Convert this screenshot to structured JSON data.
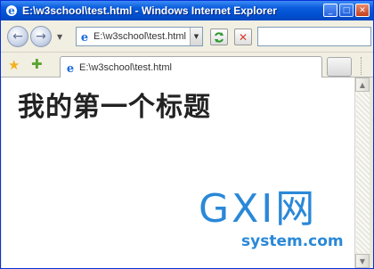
{
  "window": {
    "title": "E:\\w3school\\test.html - Windows Internet Explorer",
    "buttons": {
      "minimize": "_",
      "maximize": "□",
      "close": "✕"
    }
  },
  "navigation": {
    "back_icon": "back-arrow-icon",
    "forward_icon": "forward-arrow-icon",
    "address": "E:\\w3school\\test.html",
    "search_placeholder": ""
  },
  "tabs": [
    {
      "label": "E:\\w3school\\test.html"
    }
  ],
  "page": {
    "heading": "我的第一个标题"
  },
  "watermark": {
    "brand": "GXI网",
    "site": "system.com"
  },
  "colors": {
    "titlebar": "#0a5ddc",
    "accent": "#2a88d8",
    "stop": "#d63a2c"
  }
}
